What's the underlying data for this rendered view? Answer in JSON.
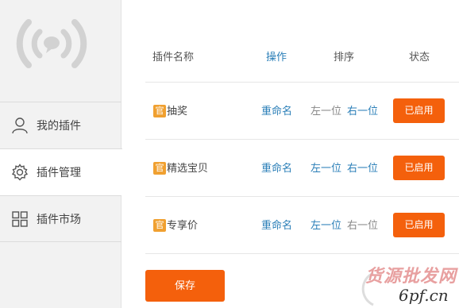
{
  "sidebar": {
    "logo_icon": "signal-broadcast-icon",
    "items": [
      {
        "label": "我的插件",
        "icon": "user-icon",
        "active": false
      },
      {
        "label": "插件管理",
        "icon": "gear-icon",
        "active": true
      },
      {
        "label": "插件市场",
        "icon": "grid-icon",
        "active": false
      }
    ]
  },
  "table": {
    "headers": {
      "name": "插件名称",
      "operation": "操作",
      "sort": "排序",
      "status": "状态"
    },
    "rows": [
      {
        "badge": "官",
        "name": "抽奖",
        "rename": "重命名",
        "move_left": "左一位",
        "move_right": "右一位",
        "status": "已启用"
      },
      {
        "badge": "官",
        "name": "精选宝贝",
        "rename": "重命名",
        "move_left": "左一位",
        "move_right": "右一位",
        "status": "已启用"
      },
      {
        "badge": "官",
        "name": "专享价",
        "rename": "重命名",
        "move_left": "左一位",
        "move_right": "右一位",
        "status": "已启用"
      }
    ]
  },
  "save_label": "保存",
  "watermark": {
    "line1": "货源批发网",
    "line2": "6pf.cn"
  },
  "colors": {
    "accent": "#f4600c",
    "link": "#2b7fb8",
    "badge": "#f0a030",
    "sidebar_bg": "#f2f2f2"
  }
}
